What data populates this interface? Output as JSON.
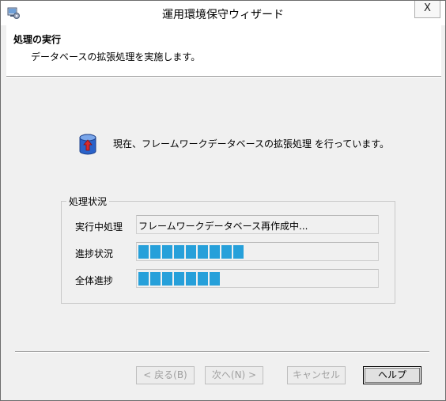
{
  "window": {
    "title": "運用環境保守ウィザード",
    "close_glyph": "X"
  },
  "header": {
    "title": "処理の実行",
    "description": "データベースの拡張処理を実施します。"
  },
  "status": {
    "icon": "database-upload-icon",
    "message": "現在、フレームワークデータベースの拡張処理 を行っています。"
  },
  "progress_group": {
    "title": "処理状況",
    "rows": [
      {
        "label": "実行中処理",
        "value": "フレームワークデータベース再作成中..."
      },
      {
        "label": "進捗状況",
        "blocks": 9
      },
      {
        "label": "全体進捗",
        "blocks": 7
      }
    ]
  },
  "buttons": {
    "back": "< 戻る(B)",
    "next": "次へ(N) >",
    "cancel": "キャンセル",
    "help": "ヘルプ"
  },
  "colors": {
    "progress": "#26a0da",
    "accent_icon": "#1f5fbf"
  }
}
